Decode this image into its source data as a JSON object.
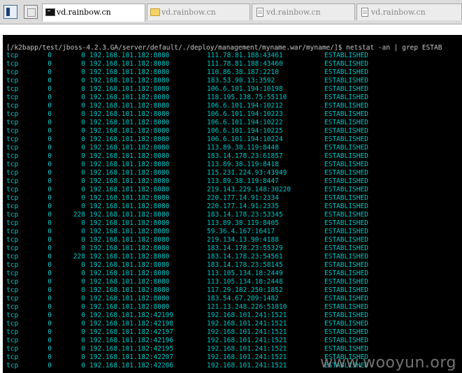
{
  "tabs": [
    {
      "label": "vd.rainbow.cn",
      "icon": "terminal-icon",
      "active": true
    },
    {
      "label": "vd.rainbow.cn",
      "icon": "folder-icon",
      "active": false
    },
    {
      "label": "vd.rainbow.cn",
      "icon": "document-icon",
      "active": false
    },
    {
      "label": "vd.rainbow.cn",
      "icon": "document-icon",
      "active": false
    }
  ],
  "terminal": {
    "command_line": "[/k2bapp/test/jboss-4.2.3.GA/server/default/./deploy/management/myname.war/myname/]$ netstat -an | grep ESTAB",
    "rows": [
      [
        "tcp",
        "0",
        "0",
        "192.168.101.182:8080",
        "111.78.81.188:43461",
        "ESTABLISHED"
      ],
      [
        "tcp",
        "0",
        "0",
        "192.168.101.182:8080",
        "111.78.81.188:43460",
        "ESTABLISHED"
      ],
      [
        "tcp",
        "0",
        "0",
        "192.168.101.182:8080",
        "110.86.38.187:2210",
        "ESTABLISHED"
      ],
      [
        "tcp",
        "0",
        "0",
        "192.168.101.182:8080",
        "183.53.90.13:3592",
        "ESTABLISHED"
      ],
      [
        "tcp",
        "0",
        "0",
        "192.168.101.182:8080",
        "106.6.101.194:10198",
        "ESTABLISHED"
      ],
      [
        "tcp",
        "0",
        "0",
        "192.168.101.182:8080",
        "118.195.138.75:55110",
        "ESTABLISHED"
      ],
      [
        "tcp",
        "0",
        "0",
        "192.168.101.182:8080",
        "106.6.101.194:10212",
        "ESTABLISHED"
      ],
      [
        "tcp",
        "0",
        "0",
        "192.168.101.182:8080",
        "106.6.101.194:10223",
        "ESTABLISHED"
      ],
      [
        "tcp",
        "0",
        "0",
        "192.168.101.182:8080",
        "106.6.101.194:10222",
        "ESTABLISHED"
      ],
      [
        "tcp",
        "0",
        "0",
        "192.168.101.182:8080",
        "106.6.101.194:10225",
        "ESTABLISHED"
      ],
      [
        "tcp",
        "0",
        "0",
        "192.168.101.182:8080",
        "106.6.101.194:10224",
        "ESTABLISHED"
      ],
      [
        "tcp",
        "0",
        "0",
        "192.168.101.182:8080",
        "113.89.38.119:8448",
        "ESTABLISHED"
      ],
      [
        "tcp",
        "0",
        "0",
        "192.168.101.182:8080",
        "183.14.178.23:61857",
        "ESTABLISHED"
      ],
      [
        "tcp",
        "0",
        "0",
        "192.168.101.182:8080",
        "113.89.38.119:8418",
        "ESTABLISHED"
      ],
      [
        "tcp",
        "0",
        "0",
        "192.168.101.182:8080",
        "115.231.224.93:43949",
        "ESTABLISHED"
      ],
      [
        "tcp",
        "0",
        "0",
        "192.168.101.182:8080",
        "113.89.38.119:8447",
        "ESTABLISHED"
      ],
      [
        "tcp",
        "0",
        "0",
        "192.168.101.182:8080",
        "219.143.229.148:30220",
        "ESTABLISHED"
      ],
      [
        "tcp",
        "0",
        "0",
        "192.168.101.182:8080",
        "220.177.14.91:2334",
        "ESTABLISHED"
      ],
      [
        "tcp",
        "0",
        "0",
        "192.168.101.182:8080",
        "220.177.14.91:2335",
        "ESTABLISHED"
      ],
      [
        "tcp",
        "0",
        "228",
        "192.168.101.182:8080",
        "183.14.178.23:53345",
        "ESTABLISHED"
      ],
      [
        "tcp",
        "0",
        "0",
        "192.168.101.182:8080",
        "113.89.38.119:8405",
        "ESTABLISHED"
      ],
      [
        "tcp",
        "0",
        "0",
        "192.168.101.182:8080",
        "59.36.4.167:16417",
        "ESTABLISHED"
      ],
      [
        "tcp",
        "0",
        "0",
        "192.168.101.182:8080",
        "219.134.13.90:4188",
        "ESTABLISHED"
      ],
      [
        "tcp",
        "0",
        "0",
        "192.168.101.182:8080",
        "183.14.178.23:55329",
        "ESTABLISHED"
      ],
      [
        "tcp",
        "0",
        "228",
        "192.168.101.182:8080",
        "183.14.178.23:54561",
        "ESTABLISHED"
      ],
      [
        "tcp",
        "0",
        "0",
        "192.168.101.182:8080",
        "183.14.178.23:58145",
        "ESTABLISHED"
      ],
      [
        "tcp",
        "0",
        "0",
        "192.168.101.182:8080",
        "113.105.134.18:2449",
        "ESTABLISHED"
      ],
      [
        "tcp",
        "0",
        "0",
        "192.168.101.182:8080",
        "113.105.134.18:2448",
        "ESTABLISHED"
      ],
      [
        "tcp",
        "0",
        "0",
        "192.168.101.182:8080",
        "117.29.182.250:1852",
        "ESTABLISHED"
      ],
      [
        "tcp",
        "0",
        "0",
        "192.168.101.182:8080",
        "183.54.67.209:1482",
        "ESTABLISHED"
      ],
      [
        "tcp",
        "0",
        "0",
        "192.168.101.182:8080",
        "121.13.248.226:51810",
        "ESTABLISHED"
      ],
      [
        "tcp",
        "0",
        "0",
        "192.168.101.182:42199",
        "192.168.101.241:1521",
        "ESTABLISHED"
      ],
      [
        "tcp",
        "0",
        "0",
        "192.168.101.182:42198",
        "192.168.101.241:1521",
        "ESTABLISHED"
      ],
      [
        "tcp",
        "0",
        "0",
        "192.168.101.182:42197",
        "192.168.101.241:1521",
        "ESTABLISHED"
      ],
      [
        "tcp",
        "0",
        "0",
        "192.168.101.182:42196",
        "192.168.101.241:1521",
        "ESTABLISHED"
      ],
      [
        "tcp",
        "0",
        "0",
        "192.168.101.182:42195",
        "192.168.101.241:1521",
        "ESTABLISHED"
      ],
      [
        "tcp",
        "0",
        "0",
        "192.168.101.182:42207",
        "192.168.101.241:1521",
        "ESTABLISHED"
      ],
      [
        "tcp",
        "0",
        "0",
        "192.168.101.182:42206",
        "192.168.101.241:1521",
        "ESTABLISHED"
      ]
    ]
  },
  "watermark": "www.wooyun.org"
}
